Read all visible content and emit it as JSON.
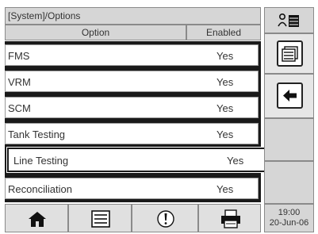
{
  "title": "[System]/Options",
  "columns": {
    "option": "Option",
    "enabled": "Enabled"
  },
  "rows": [
    {
      "option": "FMS",
      "enabled": "Yes"
    },
    {
      "option": "VRM",
      "enabled": "Yes"
    },
    {
      "option": "SCM",
      "enabled": "Yes"
    },
    {
      "option": "Tank Testing",
      "enabled": "Yes"
    },
    {
      "option": "Line Testing",
      "enabled": "Yes",
      "selected": true
    },
    {
      "option": "Reconciliation",
      "enabled": "Yes"
    }
  ],
  "side_panel": {
    "top_icon": "user-list-icon",
    "buttons": [
      "list-view-icon",
      "back-arrow-icon"
    ]
  },
  "bottom_bar": {
    "buttons": [
      "home-icon",
      "menu-list-icon",
      "alert-icon",
      "printer-icon"
    ]
  },
  "clock": {
    "time": "19:00",
    "date": "20-Jun-06"
  }
}
